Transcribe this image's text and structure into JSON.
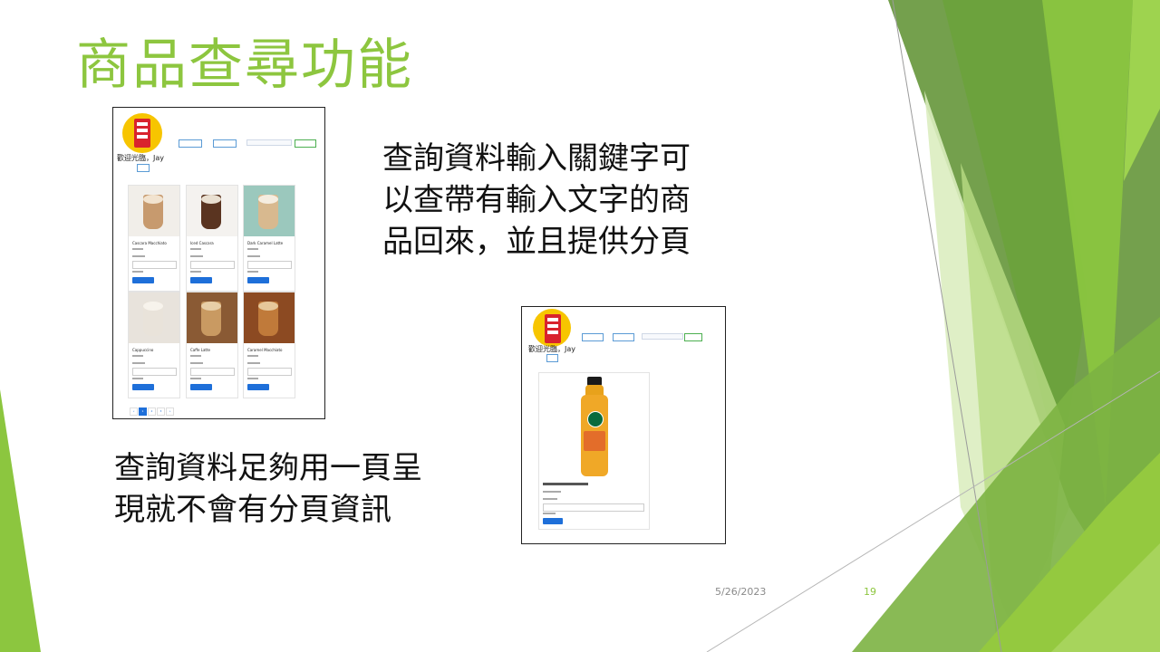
{
  "slide": {
    "title": "商品查尋功能",
    "text_top": "查詢資料輸入關鍵字可\n以查帶有輸入文字的商\n品回來，並且提供分頁",
    "text_bottom": "查詢資料足夠用一頁呈\n現就不會有分頁資訊",
    "date": "5/26/2023",
    "page_number": "19"
  },
  "colors": {
    "accent": "#8dc63f",
    "dark_green": "#4e8a1f",
    "light_green": "#c8e29a",
    "button_blue": "#1e6fd9"
  },
  "shot1": {
    "welcome": "歡迎光臨，Jay",
    "products": [
      {
        "name": "Cascara Macchiato",
        "cup": "#c79a6e",
        "foam": "#f2e3cf",
        "bg": "#f1eee9"
      },
      {
        "name": "Iced Cascara",
        "cup": "#5a3420",
        "foam": "#e9dfd0",
        "bg": "#f4f2ef"
      },
      {
        "name": "Dark Caramel Latte",
        "cup": "#d8b98f",
        "foam": "#f5ede0",
        "bg": "#9bc8bd"
      },
      {
        "name": "Cappuccino",
        "cup": "#e9e3da",
        "foam": "#f7f3ec",
        "bg": "#e8e3dc"
      },
      {
        "name": "Caffe Latte",
        "cup": "#c99a62",
        "foam": "#e8cfa8",
        "bg": "#8a5a34"
      },
      {
        "name": "Caramel Macchiato",
        "cup": "#c07a3a",
        "foam": "#e6c79a",
        "bg": "#8c4a22"
      }
    ],
    "pager": [
      "«",
      "1",
      "2",
      "3",
      "»"
    ]
  },
  "shot2": {
    "welcome": "歡迎光臨，Jay"
  }
}
